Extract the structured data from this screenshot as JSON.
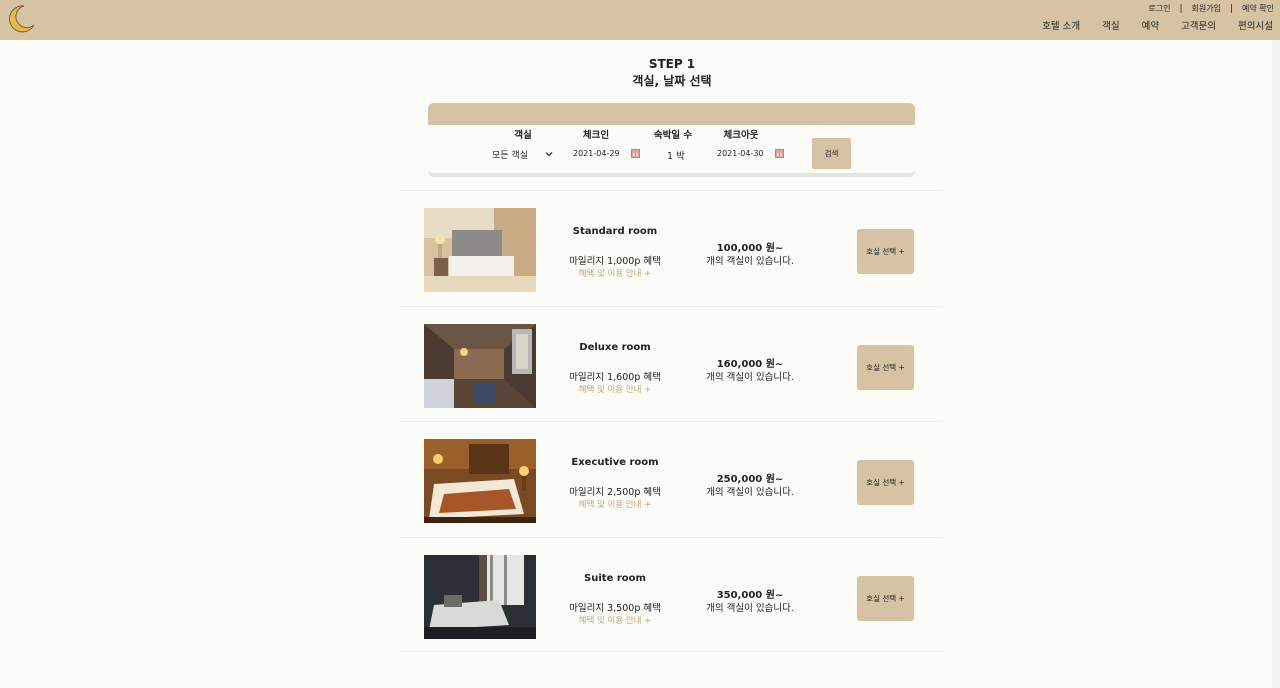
{
  "header": {
    "top_links": [
      "로그인",
      "회원가입",
      "예약 확인"
    ],
    "separator": "|",
    "nav": [
      "호텔 소개",
      "객실",
      "예약",
      "고객문의",
      "편의시설"
    ]
  },
  "step": {
    "line1": "STEP 1",
    "line2": "객실, 날짜 선택"
  },
  "search": {
    "labels": {
      "room": "객실",
      "checkin": "체크인",
      "nights": "숙박일 수",
      "checkout": "체크아웃"
    },
    "room_value": "모든 객실",
    "checkin_value": "2021-04-29",
    "nights_value": "1 박",
    "checkout_value": "2021-04-30",
    "search_button": "검색"
  },
  "rooms": [
    {
      "name": "Standard room",
      "mileage": "마일리지 1,000p 혜택",
      "benefit": "혜택 및 이용 안내 +",
      "price": "100,000 원~",
      "availability": "개의 객실이 있습니다.",
      "button": "호실 선택 +"
    },
    {
      "name": "Deluxe room",
      "mileage": "마일리지 1,600p 혜택",
      "benefit": "혜택 및 이용 안내 +",
      "price": "160,000 원~",
      "availability": "개의 객실이 있습니다.",
      "button": "호실 선택 +"
    },
    {
      "name": "Executive room",
      "mileage": "마일리지 2,500p 혜택",
      "benefit": "혜택 및 이용 안내 +",
      "price": "250,000 원~",
      "availability": "개의 객실이 있습니다.",
      "button": "호실 선택 +"
    },
    {
      "name": "Suite room",
      "mileage": "마일리지 3,500p 혜택",
      "benefit": "혜택 및 이용 안내 +",
      "price": "350,000 원~",
      "availability": "개의 객실이 있습니다.",
      "button": "호실 선택 +"
    }
  ],
  "colors": {
    "accent": "#d5c3a3",
    "benefit_text": "#c9a57a",
    "background": "#fbfbf7"
  }
}
